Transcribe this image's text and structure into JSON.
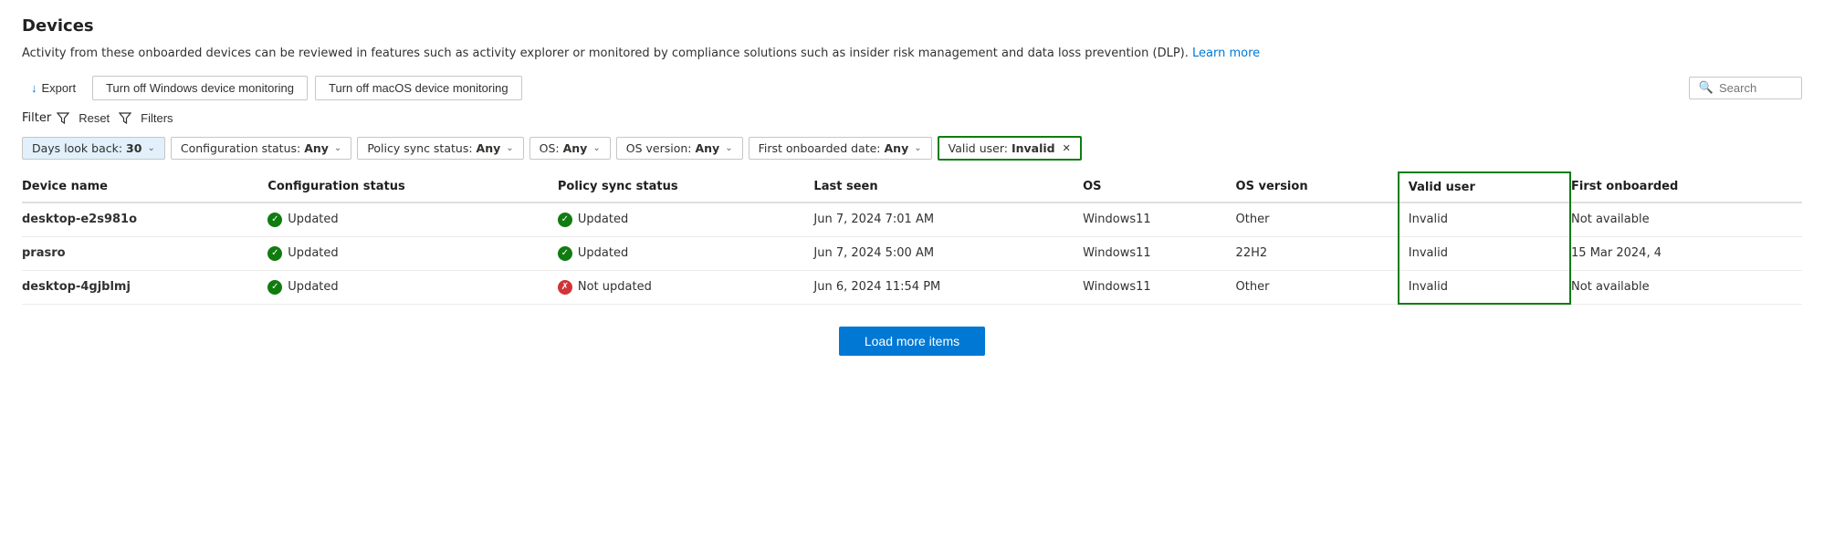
{
  "page": {
    "title": "Devices",
    "description": "Activity from these onboarded devices can be reviewed in features such as activity explorer or monitored by compliance solutions such as insider risk management and data loss prevention (DLP).",
    "learn_more_label": "Learn more"
  },
  "toolbar": {
    "export_label": "Export",
    "win_monitor_label": "Turn off Windows device monitoring",
    "mac_monitor_label": "Turn off macOS device monitoring",
    "search_placeholder": "Search"
  },
  "filter_row": {
    "filter_label": "Filter",
    "reset_label": "Reset",
    "filters_label": "Filters"
  },
  "filter_chips": [
    {
      "id": "days",
      "label": "Days look back:",
      "value": "30",
      "active": true
    },
    {
      "id": "config",
      "label": "Configuration status:",
      "value": "Any"
    },
    {
      "id": "policy",
      "label": "Policy sync status:",
      "value": "Any"
    },
    {
      "id": "os",
      "label": "OS:",
      "value": "Any"
    },
    {
      "id": "osversion",
      "label": "OS version:",
      "value": "Any"
    },
    {
      "id": "onboarded",
      "label": "First onboarded date:",
      "value": "Any"
    }
  ],
  "active_filter": {
    "label": "Valid user:",
    "value": "Invalid"
  },
  "table": {
    "columns": [
      {
        "id": "device_name",
        "label": "Device name"
      },
      {
        "id": "config_status",
        "label": "Configuration status"
      },
      {
        "id": "policy_sync_status",
        "label": "Policy sync status"
      },
      {
        "id": "last_seen",
        "label": "Last seen"
      },
      {
        "id": "os",
        "label": "OS"
      },
      {
        "id": "os_version",
        "label": "OS version"
      },
      {
        "id": "valid_user",
        "label": "Valid user"
      },
      {
        "id": "first_onboarded",
        "label": "First onboarded"
      }
    ],
    "rows": [
      {
        "device_name": "desktop-e2s981o",
        "config_status": "Updated",
        "config_status_ok": true,
        "policy_sync_status": "Updated",
        "policy_sync_ok": true,
        "last_seen": "Jun 7, 2024 7:01 AM",
        "os": "Windows11",
        "os_version": "Other",
        "valid_user": "Invalid",
        "first_onboarded": "Not available"
      },
      {
        "device_name": "prasro",
        "config_status": "Updated",
        "config_status_ok": true,
        "policy_sync_status": "Updated",
        "policy_sync_ok": true,
        "last_seen": "Jun 7, 2024 5:00 AM",
        "os": "Windows11",
        "os_version": "22H2",
        "valid_user": "Invalid",
        "first_onboarded": "15 Mar 2024, 4"
      },
      {
        "device_name": "desktop-4gjblmj",
        "config_status": "Updated",
        "config_status_ok": true,
        "policy_sync_status": "Not updated",
        "policy_sync_ok": false,
        "last_seen": "Jun 6, 2024 11:54 PM",
        "os": "Windows11",
        "os_version": "Other",
        "valid_user": "Invalid",
        "first_onboarded": "Not available"
      }
    ]
  },
  "load_more_label": "Load more items"
}
